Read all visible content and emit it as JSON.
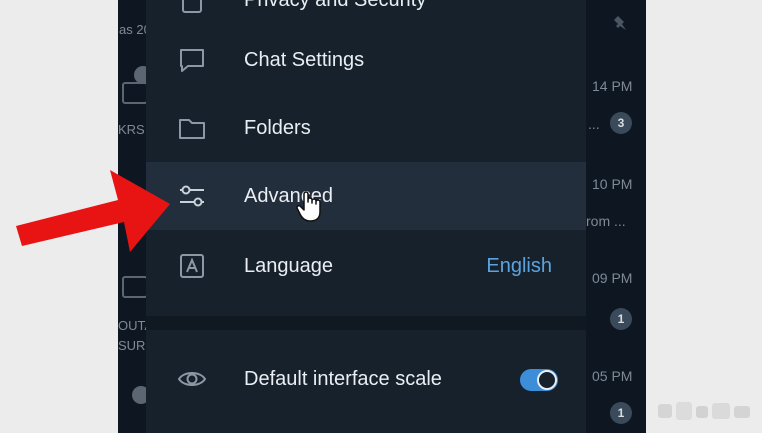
{
  "left_partial": {
    "date_text": "as 20",
    "badge_top": "",
    "folder_1_label": "KRS",
    "folder_2_label_a": "OUTA",
    "folder_2_label_b": "SURU"
  },
  "settings": {
    "top_item_partial": "Privacy and Security",
    "items": [
      {
        "label": "Chat Settings",
        "icon": "chat-bubble-icon"
      },
      {
        "label": "Folders",
        "icon": "folder-icon"
      },
      {
        "label": "Advanced",
        "icon": "sliders-icon"
      },
      {
        "label": "Language",
        "icon": "language-icon",
        "value": "English"
      }
    ],
    "scale": {
      "label": "Default interface scale",
      "icon": "eye-icon",
      "enabled": true
    }
  },
  "chat_list_partial": {
    "times": [
      "14 PM",
      "10 PM",
      "09 PM",
      "05 PM"
    ],
    "preview": "rom ...",
    "ellipsis": "...",
    "badges": [
      "3",
      "1",
      "1"
    ]
  },
  "colors": {
    "panel_bg": "#17212b",
    "hover_row": "#232e3c",
    "accent": "#5aa3e0",
    "toggle_on": "#3c8ed8",
    "arrow": "#e81414"
  }
}
